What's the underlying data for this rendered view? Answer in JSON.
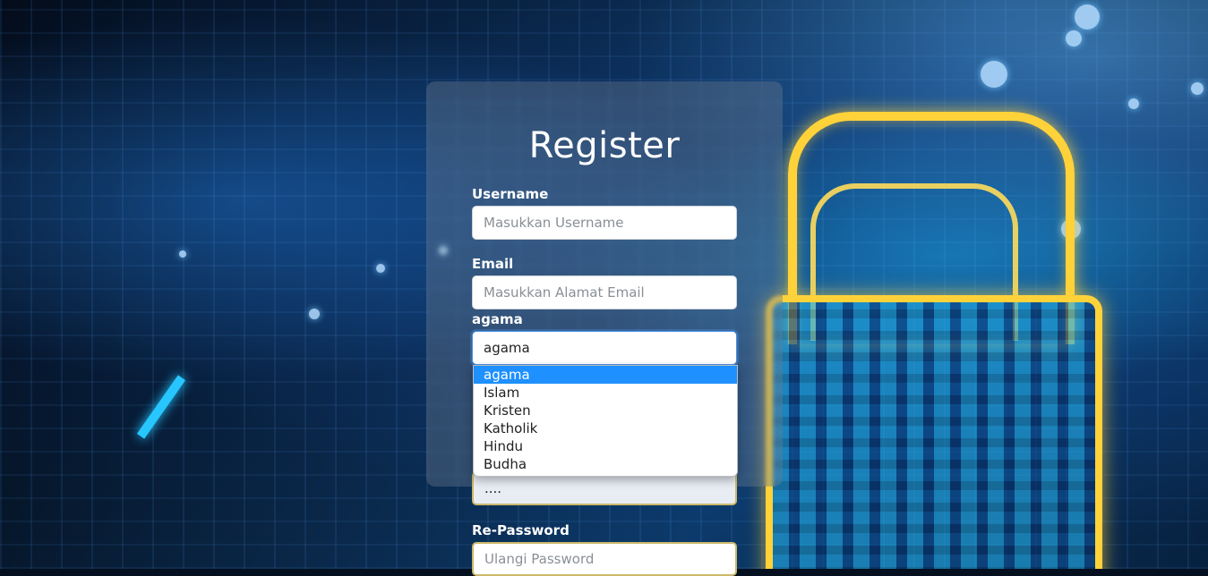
{
  "form": {
    "title": "Register",
    "username": {
      "label": "Username",
      "placeholder": "Masukkan Username"
    },
    "email": {
      "label": "Email",
      "placeholder": "Masukkan Alamat Email"
    },
    "agama": {
      "label": "agama",
      "selected": "agama",
      "options": [
        "agama",
        "Islam",
        "Kristen",
        "Katholik",
        "Hindu",
        "Budha"
      ]
    },
    "password": {
      "value": "...."
    },
    "repassword": {
      "label": "Re-Password",
      "placeholder": "Ulangi Password"
    }
  },
  "colors": {
    "accent": "#1e90ff",
    "lock_glow": "#ffd23a"
  }
}
